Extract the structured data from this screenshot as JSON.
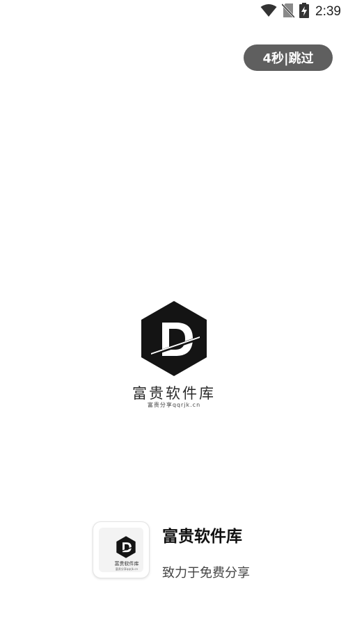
{
  "status_bar": {
    "time": "2:39",
    "icons": [
      "wifi-icon",
      "no-sim-icon",
      "battery-charging-icon"
    ]
  },
  "skip": {
    "label": "4秒|跳过"
  },
  "splash_logo": {
    "title": "富贵软件库",
    "subtitle": "富贵分享qqrjk.cn",
    "icon": "hexagon-d-logo-icon"
  },
  "bottom": {
    "app_name": "富贵软件库",
    "slogan": "致力于免费分享",
    "icon_title": "富贵软件库",
    "icon_subtitle": "富贵分享qqrjk.cn"
  },
  "colors": {
    "background": "#ffffff",
    "logo": "#141414",
    "skip_button": "#5f5f5f"
  }
}
